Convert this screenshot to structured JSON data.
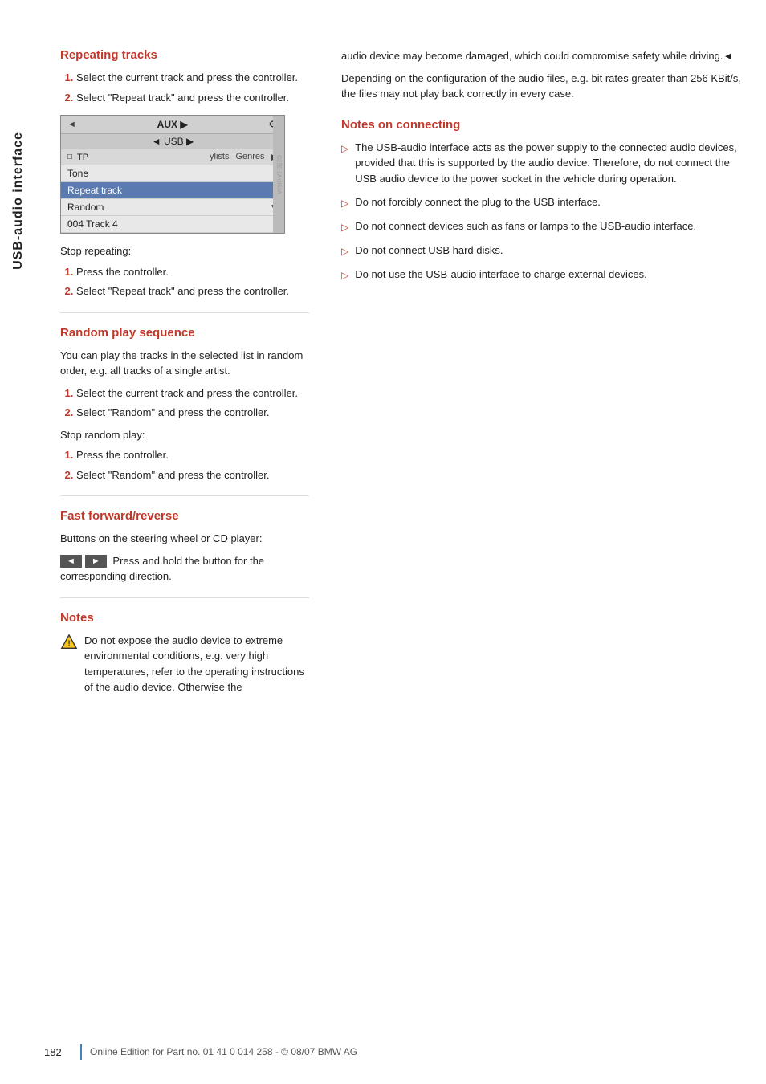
{
  "sidebar": {
    "label": "USB-audio interface"
  },
  "left": {
    "repeating_tracks": {
      "heading": "Repeating tracks",
      "steps": [
        "Select the current track and press the controller.",
        "Select \"Repeat track\" and press the controller."
      ],
      "ui": {
        "top_bar_left": "◄",
        "top_bar_center": "AUX ▶",
        "top_bar_right": "◄",
        "second_bar": "◄ USB ▶",
        "rows": [
          {
            "icon": "□",
            "label": "TP",
            "tabs": [
              "ylists",
              "Genres"
            ],
            "has_arrow": true
          },
          {
            "label": "Tone",
            "selected": false
          },
          {
            "label": "Repeat track",
            "selected": false
          },
          {
            "label": "Random",
            "selected": false,
            "has_sub_arrow": true
          },
          {
            "label": "004 Track 4",
            "selected": false
          }
        ]
      },
      "stop_label": "Stop repeating:",
      "stop_steps": [
        "Press the controller.",
        "Select \"Repeat track\" and press the controller."
      ]
    },
    "random_play": {
      "heading": "Random play sequence",
      "intro": "You can play the tracks in the selected list in random order, e.g. all tracks of a single artist.",
      "steps": [
        "Select the current track and press the controller.",
        "Select \"Random\" and press the controller."
      ],
      "stop_label": "Stop random play:",
      "stop_steps": [
        "Press the controller.",
        "Select \"Random\" and press the controller."
      ]
    },
    "fast_forward": {
      "heading": "Fast forward/reverse",
      "intro": "Buttons on the steering wheel or CD player:",
      "btn_left": "◄",
      "btn_right": "►",
      "btn_text": "Press and hold the button for the corresponding direction."
    },
    "notes": {
      "heading": "Notes",
      "warning_text": "Do not expose the audio device to extreme environmental conditions, e.g. very high temperatures, refer to the operating instructions of the audio device. Otherwise the"
    }
  },
  "right": {
    "continued_text": "audio device may become damaged, which could compromise safety while driving.◄",
    "bit_rate_text": "Depending on the configuration of the audio files, e.g. bit rates greater than 256 KBit/s, the files may not play back correctly in every case.",
    "notes_on_connecting": {
      "heading": "Notes on connecting",
      "bullets": [
        "The USB-audio interface acts as the power supply to the connected audio devices, provided that this is supported by the audio device. Therefore, do not connect the USB audio device to the power socket in the vehicle during operation.",
        "Do not forcibly connect the plug to the USB interface.",
        "Do not connect devices such as fans or lamps to the USB-audio interface.",
        "Do not connect USB hard disks.",
        "Do not use the USB-audio interface to charge external devices."
      ]
    }
  },
  "footer": {
    "page_number": "182",
    "text": "Online Edition for Part no. 01 41 0 014 258 - © 08/07 BMW AG"
  }
}
